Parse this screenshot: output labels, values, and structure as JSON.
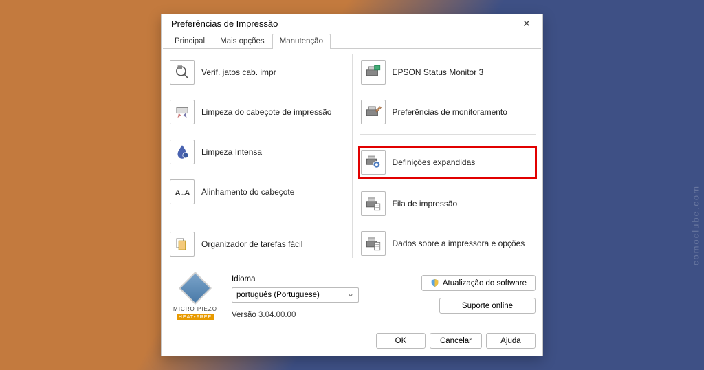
{
  "watermark": "comoclube.com",
  "dialog": {
    "title": "Preferências de Impressão"
  },
  "tabs": {
    "principal": "Principal",
    "mais_opcoes": "Mais opções",
    "manutencao": "Manutenção"
  },
  "left_items": {
    "nozzle_check": "Verif. jatos cab. impr",
    "head_cleaning": "Limpeza do cabeçote de impressão",
    "power_cleaning": "Limpeza Intensa",
    "head_alignment": "Alinhamento do cabeçote",
    "job_arranger": "Organizador de tarefas fácil"
  },
  "right_items": {
    "status_monitor": "EPSON Status Monitor 3",
    "monitoring_prefs": "Preferências de monitoramento",
    "extended_settings": "Definições expandidas",
    "print_queue": "Fila de impressão",
    "printer_info": "Dados sobre a impressora e opções"
  },
  "bottom": {
    "logo_line1": "MICRO PIEZO",
    "logo_line2": "HEAT•FREE",
    "language_label": "Idioma",
    "language_value": "português (Portuguese)",
    "version": "Versão 3.04.00.00",
    "software_update": "Atualização do software",
    "online_support": "Suporte online"
  },
  "footer": {
    "ok": "OK",
    "cancel": "Cancelar",
    "help": "Ajuda"
  }
}
